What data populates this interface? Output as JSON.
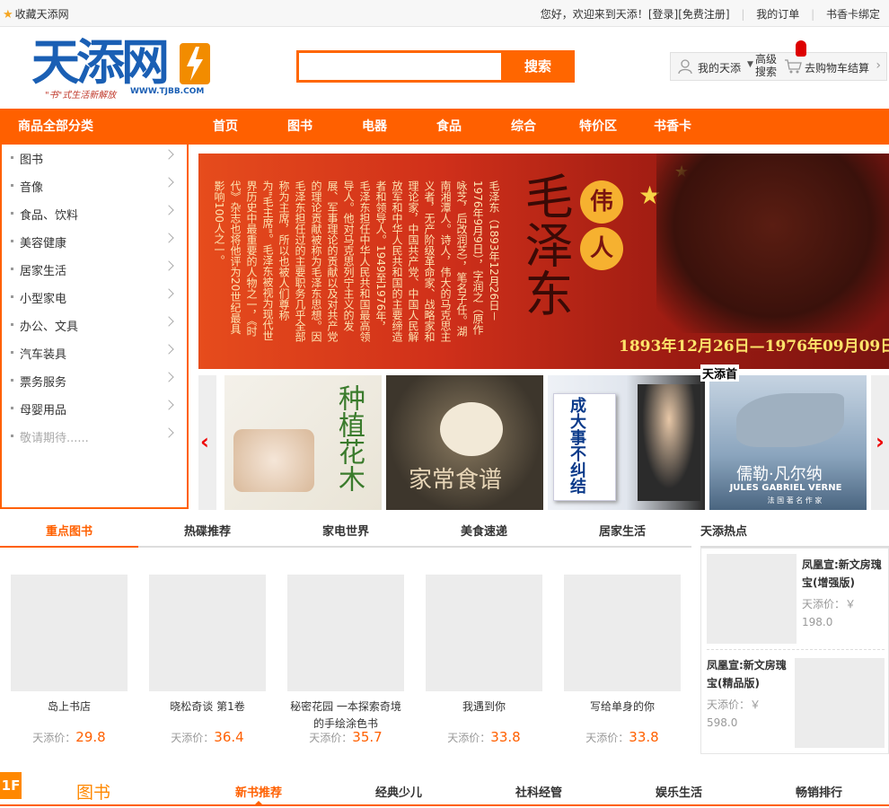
{
  "topbar": {
    "favorite": "收藏天添网",
    "greeting": "您好，欢迎来到天添！",
    "login": "[登录]",
    "register": "[免费注册]",
    "my_orders": "我的订单",
    "card_bind": "书香卡绑定"
  },
  "logo": {
    "name": "天添网",
    "slogan": "\"书\"式生活新解放",
    "url": "WWW.TJBB.COM"
  },
  "search": {
    "placeholder": "",
    "button": "搜索"
  },
  "account": {
    "my_tiantian": "我的天添",
    "advanced_search": "高级搜索",
    "cart": "去购物车结算"
  },
  "nav": {
    "all_categories": "商品全部分类",
    "items": [
      "首页",
      "图书",
      "电器",
      "食品",
      "综合",
      "特价区",
      "书香卡"
    ]
  },
  "sidebar": {
    "items": [
      "图书",
      "音像",
      "食品、饮料",
      "美容健康",
      "居家生活",
      "小型家电",
      "办公、文具",
      "汽车装具",
      "票务服务",
      "母婴用品",
      "敬请期待......"
    ]
  },
  "banner": {
    "bio": "毛泽东（1893年12月26日－1976年9月9日），字润之（原作咏芝，后改润芝），笔名子任。湖南湘潭人。诗人，伟大的马克思主义者，无产阶级革命家、战略家和理论家，中国共产党、中国人民解放军和中华人民共和国的主要缔造者和领导人。1949至1976年，毛泽东担任中华人民共和国最高领导人。他对马克思列宁主义的发展、军事理论的贡献以及对共产党的理论贡献被称为毛泽东思想。因毛泽东担任过的主要职务几乎全部称为主席，所以也被人们尊称为\"毛主席\"。毛泽东被视为现代世界历史中最重要的人物之一，《时代》杂志也将他评为20世纪最具影响100人之一。",
    "calligraphy": "毛泽东",
    "badge1": "伟",
    "badge2": "人",
    "dates": "1893年12月26日—1976年09月09日"
  },
  "carousel": {
    "slides": [
      {
        "caption": "种植花木"
      },
      {
        "caption": "家常食谱"
      },
      {
        "caption": "成大事不纠结"
      },
      {
        "caption": "儒勒·凡尔纳",
        "sub": "JULES GABRIEL VERNE",
        "sub2": "法 国 著 名 作 家"
      }
    ],
    "overlay_label": "天添首"
  },
  "tabs": [
    "重点图书",
    "热碟推荐",
    "家电世界",
    "美食速递",
    "居家生活"
  ],
  "price_label": "天添价：",
  "products": [
    {
      "name": "岛上书店",
      "price": "29.8"
    },
    {
      "name": "晓松奇谈 第1卷",
      "price": "36.4"
    },
    {
      "name": "秘密花园 一本探索奇境的手绘涂色书",
      "price": "35.7"
    },
    {
      "name": "我遇到你",
      "price": "33.8"
    },
    {
      "name": "写给单身的你",
      "price": "33.8"
    }
  ],
  "hot": {
    "title": "天添热点",
    "items": [
      {
        "name": "凤凰宣:新文房瑰宝(增强版)",
        "price": "天添价：￥ 198.0"
      },
      {
        "name": "凤凰宣:新文房瑰宝(精品版)",
        "price": "天添价：￥ 598.0"
      }
    ]
  },
  "floor": {
    "num": "1F",
    "name": "图书",
    "tabs": [
      "新书推荐",
      "经典少儿",
      "社科经管",
      "娱乐生活",
      "畅销排行"
    ]
  },
  "colors": {
    "brand": "#ff6000",
    "accent": "#ff8800",
    "logo_blue": "#1a5fb4"
  }
}
